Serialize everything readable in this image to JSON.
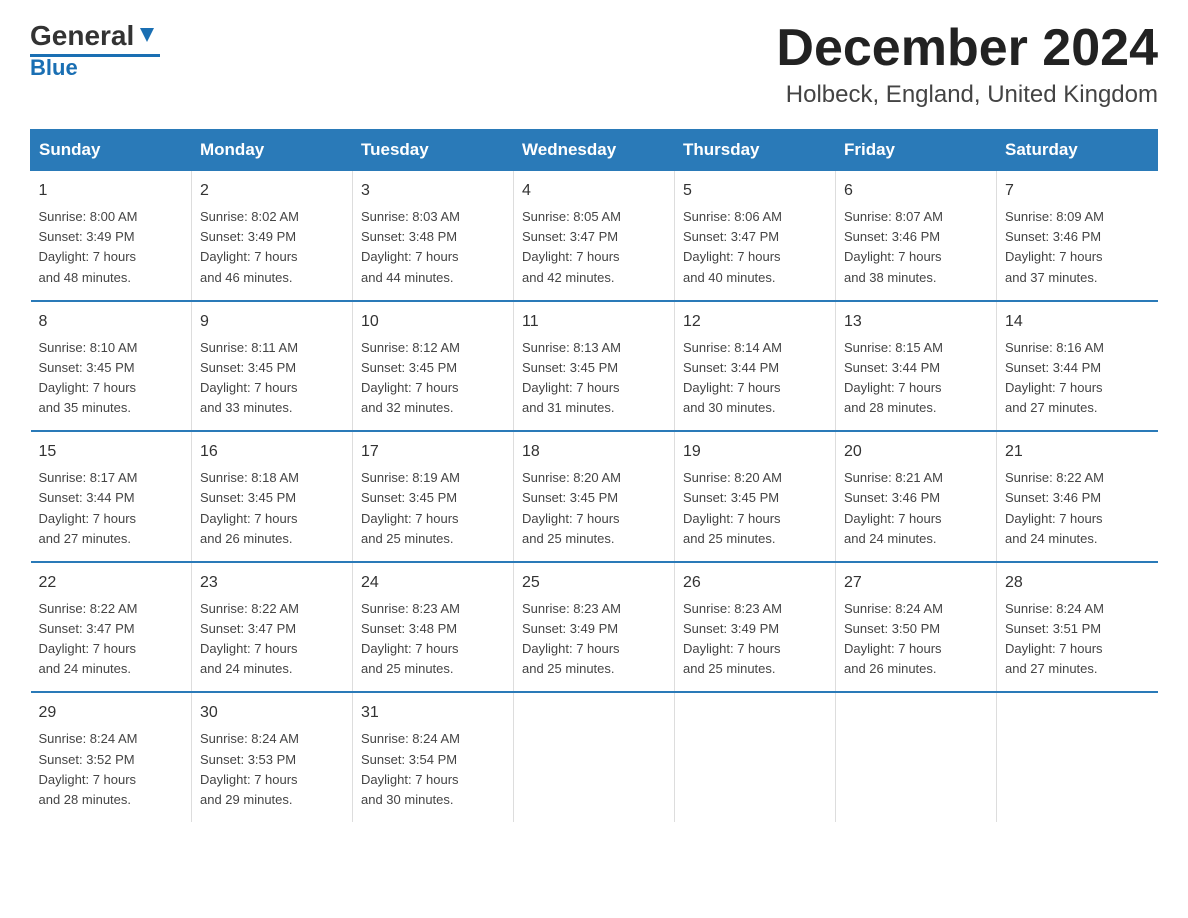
{
  "header": {
    "logo_general": "General",
    "logo_blue": "Blue",
    "title": "December 2024",
    "subtitle": "Holbeck, England, United Kingdom"
  },
  "columns": [
    "Sunday",
    "Monday",
    "Tuesday",
    "Wednesday",
    "Thursday",
    "Friday",
    "Saturday"
  ],
  "weeks": [
    [
      {
        "day": "1",
        "info": "Sunrise: 8:00 AM\nSunset: 3:49 PM\nDaylight: 7 hours\nand 48 minutes."
      },
      {
        "day": "2",
        "info": "Sunrise: 8:02 AM\nSunset: 3:49 PM\nDaylight: 7 hours\nand 46 minutes."
      },
      {
        "day": "3",
        "info": "Sunrise: 8:03 AM\nSunset: 3:48 PM\nDaylight: 7 hours\nand 44 minutes."
      },
      {
        "day": "4",
        "info": "Sunrise: 8:05 AM\nSunset: 3:47 PM\nDaylight: 7 hours\nand 42 minutes."
      },
      {
        "day": "5",
        "info": "Sunrise: 8:06 AM\nSunset: 3:47 PM\nDaylight: 7 hours\nand 40 minutes."
      },
      {
        "day": "6",
        "info": "Sunrise: 8:07 AM\nSunset: 3:46 PM\nDaylight: 7 hours\nand 38 minutes."
      },
      {
        "day": "7",
        "info": "Sunrise: 8:09 AM\nSunset: 3:46 PM\nDaylight: 7 hours\nand 37 minutes."
      }
    ],
    [
      {
        "day": "8",
        "info": "Sunrise: 8:10 AM\nSunset: 3:45 PM\nDaylight: 7 hours\nand 35 minutes."
      },
      {
        "day": "9",
        "info": "Sunrise: 8:11 AM\nSunset: 3:45 PM\nDaylight: 7 hours\nand 33 minutes."
      },
      {
        "day": "10",
        "info": "Sunrise: 8:12 AM\nSunset: 3:45 PM\nDaylight: 7 hours\nand 32 minutes."
      },
      {
        "day": "11",
        "info": "Sunrise: 8:13 AM\nSunset: 3:45 PM\nDaylight: 7 hours\nand 31 minutes."
      },
      {
        "day": "12",
        "info": "Sunrise: 8:14 AM\nSunset: 3:44 PM\nDaylight: 7 hours\nand 30 minutes."
      },
      {
        "day": "13",
        "info": "Sunrise: 8:15 AM\nSunset: 3:44 PM\nDaylight: 7 hours\nand 28 minutes."
      },
      {
        "day": "14",
        "info": "Sunrise: 8:16 AM\nSunset: 3:44 PM\nDaylight: 7 hours\nand 27 minutes."
      }
    ],
    [
      {
        "day": "15",
        "info": "Sunrise: 8:17 AM\nSunset: 3:44 PM\nDaylight: 7 hours\nand 27 minutes."
      },
      {
        "day": "16",
        "info": "Sunrise: 8:18 AM\nSunset: 3:45 PM\nDaylight: 7 hours\nand 26 minutes."
      },
      {
        "day": "17",
        "info": "Sunrise: 8:19 AM\nSunset: 3:45 PM\nDaylight: 7 hours\nand 25 minutes."
      },
      {
        "day": "18",
        "info": "Sunrise: 8:20 AM\nSunset: 3:45 PM\nDaylight: 7 hours\nand 25 minutes."
      },
      {
        "day": "19",
        "info": "Sunrise: 8:20 AM\nSunset: 3:45 PM\nDaylight: 7 hours\nand 25 minutes."
      },
      {
        "day": "20",
        "info": "Sunrise: 8:21 AM\nSunset: 3:46 PM\nDaylight: 7 hours\nand 24 minutes."
      },
      {
        "day": "21",
        "info": "Sunrise: 8:22 AM\nSunset: 3:46 PM\nDaylight: 7 hours\nand 24 minutes."
      }
    ],
    [
      {
        "day": "22",
        "info": "Sunrise: 8:22 AM\nSunset: 3:47 PM\nDaylight: 7 hours\nand 24 minutes."
      },
      {
        "day": "23",
        "info": "Sunrise: 8:22 AM\nSunset: 3:47 PM\nDaylight: 7 hours\nand 24 minutes."
      },
      {
        "day": "24",
        "info": "Sunrise: 8:23 AM\nSunset: 3:48 PM\nDaylight: 7 hours\nand 25 minutes."
      },
      {
        "day": "25",
        "info": "Sunrise: 8:23 AM\nSunset: 3:49 PM\nDaylight: 7 hours\nand 25 minutes."
      },
      {
        "day": "26",
        "info": "Sunrise: 8:23 AM\nSunset: 3:49 PM\nDaylight: 7 hours\nand 25 minutes."
      },
      {
        "day": "27",
        "info": "Sunrise: 8:24 AM\nSunset: 3:50 PM\nDaylight: 7 hours\nand 26 minutes."
      },
      {
        "day": "28",
        "info": "Sunrise: 8:24 AM\nSunset: 3:51 PM\nDaylight: 7 hours\nand 27 minutes."
      }
    ],
    [
      {
        "day": "29",
        "info": "Sunrise: 8:24 AM\nSunset: 3:52 PM\nDaylight: 7 hours\nand 28 minutes."
      },
      {
        "day": "30",
        "info": "Sunrise: 8:24 AM\nSunset: 3:53 PM\nDaylight: 7 hours\nand 29 minutes."
      },
      {
        "day": "31",
        "info": "Sunrise: 8:24 AM\nSunset: 3:54 PM\nDaylight: 7 hours\nand 30 minutes."
      },
      {
        "day": "",
        "info": ""
      },
      {
        "day": "",
        "info": ""
      },
      {
        "day": "",
        "info": ""
      },
      {
        "day": "",
        "info": ""
      }
    ]
  ]
}
